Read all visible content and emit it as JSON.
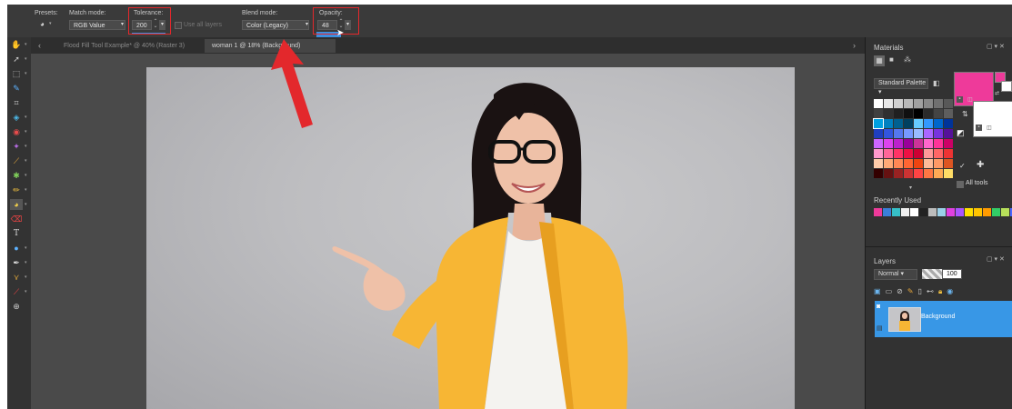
{
  "options": {
    "presets_label": "Presets:",
    "match_mode_label": "Match mode:",
    "match_mode_value": "RGB Value",
    "tolerance_label": "Tolerance:",
    "tolerance_value": "200",
    "use_all_layers_label": "Use all layers",
    "blend_mode_label": "Blend mode:",
    "blend_mode_value": "Color (Legacy)",
    "opacity_label": "Opacity:",
    "opacity_value": "48",
    "opacity_fraction": 0.48
  },
  "tabs": [
    {
      "label": "Flood Fill Tool Example* @ 40% (Raster 3)"
    },
    {
      "label": "woman 1 @ 18% (Background)"
    }
  ],
  "materials": {
    "title": "Materials",
    "palette_label": "Standard Palette",
    "recently_used_label": "Recently Used",
    "all_tools_label": "All tools",
    "foreground_color": "#ee3a9a",
    "background_color": "#ffffff",
    "palette_colors": [
      "#ffffff",
      "#e8e8e8",
      "#d0d0d0",
      "#b8b8b8",
      "#a0a0a0",
      "#888888",
      "#707070",
      "#585858",
      "#404040",
      "#303030",
      "#202020",
      "#101010",
      "#000000",
      "#2a2a2a",
      "#444444",
      "#5e5e5e",
      "#00a0e0",
      "#0080c0",
      "#006090",
      "#004060",
      "#66ccff",
      "#3399ff",
      "#0066cc",
      "#003399",
      "#1f3fbf",
      "#3355dd",
      "#5577ee",
      "#7799ff",
      "#99bbff",
      "#aa66ff",
      "#7733dd",
      "#551199",
      "#cc66ff",
      "#dd44ee",
      "#bb22cc",
      "#990099",
      "#cc3399",
      "#ff66cc",
      "#ff3399",
      "#cc0066",
      "#ff99cc",
      "#ff6699",
      "#ff3366",
      "#ee1144",
      "#cc0033",
      "#ff9999",
      "#ff6666",
      "#ee3333",
      "#ffccaa",
      "#ffaa77",
      "#ff8855",
      "#ff6633",
      "#ee4411",
      "#ffbb99",
      "#ff9966",
      "#dd5522",
      "#330000",
      "#661111",
      "#992222",
      "#cc3333",
      "#ff4444",
      "#ff7744",
      "#ffaa55",
      "#ffdd66"
    ],
    "recent_colors": [
      "#ee3a9a",
      "#3a7fd8",
      "#36c0c8",
      "#f0f0f0",
      "#ffffff",
      "#222222",
      "#bcbcbc",
      "#9ad0e8",
      "#e040e0",
      "#aa55ff",
      "#ffe000",
      "#ffc400",
      "#ff9b00",
      "#33cc66",
      "#b7e05a",
      "#4c66ff"
    ]
  },
  "layers": {
    "title": "Layers",
    "blend_value": "Normal",
    "opacity_value": "100",
    "layer_name": "Background"
  },
  "icons": {
    "toolbar": [
      "pan-icon",
      "pick-icon",
      "selection-icon",
      "freehand-selection-icon",
      "crop-icon",
      "smart-carver-icon",
      "red-eye-icon",
      "makeover-icon",
      "clone-icon",
      "scratch-remover-icon",
      "dodge-icon",
      "paint-brush-icon",
      "flood-fill-icon",
      "eraser-icon",
      "text-icon",
      "shape-icon",
      "pen-icon",
      "picture-tube-icon",
      "dropper-icon",
      "more-tools-icon"
    ]
  },
  "annotation": {
    "arrow_color": "#e3282c",
    "box_color": "#e3282c"
  }
}
